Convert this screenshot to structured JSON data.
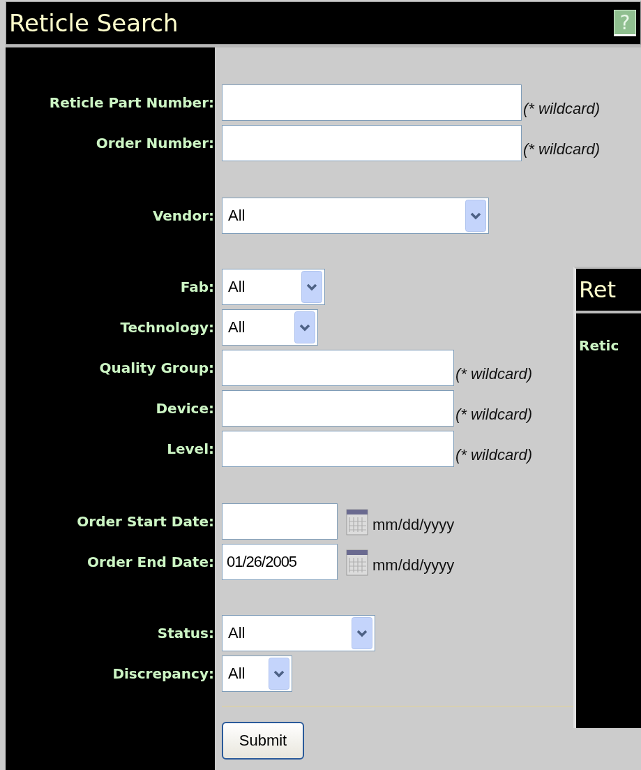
{
  "window": {
    "title": "Reticle Search",
    "help": "?"
  },
  "groups": [
    [
      {
        "label": "Reticle Part Number:",
        "kind": "text",
        "hint": "(* wildcard)"
      },
      {
        "label": "Order Number:",
        "kind": "text",
        "hint": "(* wildcard)"
      }
    ],
    [
      {
        "label": "Vendor:",
        "kind": "select",
        "value": "All"
      }
    ],
    [
      {
        "label": "Fab:",
        "kind": "select",
        "value": "All"
      },
      {
        "label": "Technology:",
        "kind": "select",
        "value": "All"
      },
      {
        "label": "Quality Group:",
        "kind": "text",
        "hint": "(* wildcard)"
      },
      {
        "label": "Device:",
        "kind": "text",
        "hint": "(* wildcard)"
      },
      {
        "label": "Level:",
        "kind": "text",
        "hint": "(* wildcard)"
      }
    ],
    [
      {
        "label": "Order Start Date:",
        "kind": "date",
        "hint": "mm/dd/yyyy"
      },
      {
        "label": "Order End Date:",
        "kind": "date",
        "value": "01/26/2005",
        "hint": "mm/dd/yyyy"
      }
    ],
    [
      {
        "label": "Status:",
        "kind": "select",
        "value": "All"
      },
      {
        "label": "Discrepancy:",
        "kind": "select",
        "value": "All"
      }
    ]
  ],
  "submit": "Submit",
  "overlay_panel": {
    "title": "Ret",
    "label": "Retic"
  }
}
